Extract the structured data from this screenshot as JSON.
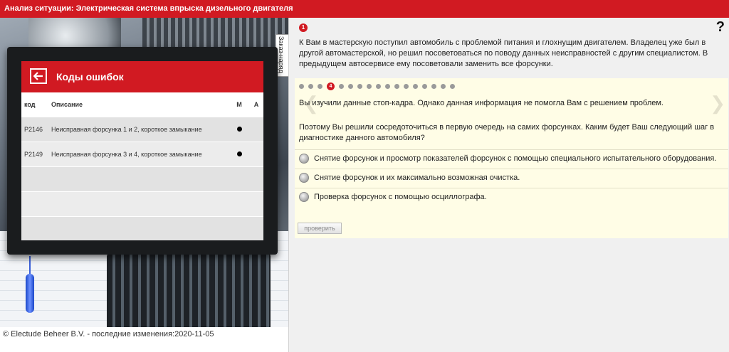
{
  "window": {
    "title": "Анализ ситуации: Электрическая система впрыска дизельного двигателя"
  },
  "side_tab": {
    "label": "Заказ-наряд"
  },
  "fault_codes": {
    "title": "Коды ошибок",
    "columns": {
      "code": "код",
      "description": "Описание",
      "m": "M",
      "a": "A"
    },
    "rows": [
      {
        "code": "P2146",
        "description": "Неисправная форсунка 1 и 2, короткое замыкание",
        "m": true,
        "a": false
      },
      {
        "code": "P2149",
        "description": "Неисправная форсунка 3 и 4, короткое замыкание",
        "m": true,
        "a": false
      }
    ]
  },
  "footer": {
    "copyright": "© Electude Beheer B.V. - последние изменения:2020-11-05"
  },
  "intro": {
    "number": "1",
    "text": "К Вам в мастерскую поступил автомобиль с проблемой питания и глохнущим двигателем. Владелец уже был в другой автомастерской, но решил посоветоваться по поводу данных неисправностей с другим специалистом. В предыдущем автосервисе ему посоветовали заменить все форсунки."
  },
  "help": {
    "label": "?"
  },
  "question": {
    "current_step": "4",
    "total_steps": 17,
    "current_index": 3,
    "text1": "Вы изучили данные стоп-кадра. Однако данная информация не помогла Вам с решением проблем.",
    "text2": "Поэтому Вы решили сосредоточиться в первую очередь на самих форсунках. Каким будет Ваш следующий шаг в диагностике данного автомобиля?",
    "options": [
      "Снятие форсунок и просмотр показателей форсунок с помощью специального испытательного оборудования.",
      "Снятие форсунок и их максимально возможная очистка.",
      "Проверка форсунок с помощью осциллографа."
    ],
    "check_label": "проверить"
  },
  "colors": {
    "accent": "#d11a22",
    "question_bg": "#fffde6"
  },
  "icons": {
    "back": "back-arrow-icon",
    "help": "help-icon",
    "nav_prev": "chevron-left-icon",
    "nav_next": "chevron-right-icon"
  }
}
